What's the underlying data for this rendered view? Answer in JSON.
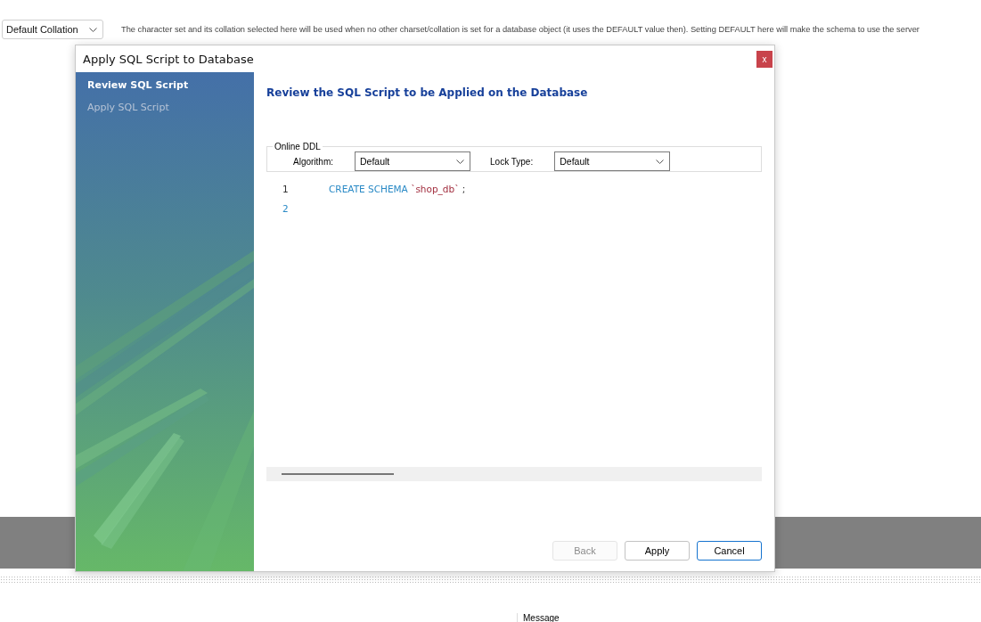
{
  "background": {
    "collation_select": {
      "value": "Default Collation"
    },
    "description": "The character set and its collation selected here will be used when no other charset/collation is set for a database object (it uses the DEFAULT value then). Setting DEFAULT here will make the schema to use the server",
    "message_header": "Message"
  },
  "dialog": {
    "title": "Apply SQL Script to Database",
    "close": "x",
    "steps": [
      {
        "label": "Review SQL Script",
        "selected": true
      },
      {
        "label": "Apply SQL Script",
        "selected": false
      }
    ],
    "heading": "Review the SQL Script to be Applied on the Database",
    "online_ddl": {
      "legend": "Online DDL",
      "algorithm_label": "Algorithm:",
      "algorithm": "Default",
      "lock_label": "Lock Type:",
      "lock": "Default"
    },
    "script_lines": [
      {
        "number": "1",
        "current": false,
        "tokens": [
          {
            "kind": "keyword",
            "text": "CREATE SCHEMA"
          },
          {
            "kind": "identifier",
            "text": "`shop_db`"
          },
          {
            "kind": "plain",
            "text": ";"
          }
        ]
      },
      {
        "number": "2",
        "current": true
      }
    ],
    "buttons": [
      {
        "label": "Back",
        "disabled": true,
        "selected": false
      },
      {
        "label": "Apply",
        "disabled": false,
        "selected": false
      },
      {
        "label": "Cancel",
        "disabled": false,
        "selected": true
      }
    ]
  }
}
